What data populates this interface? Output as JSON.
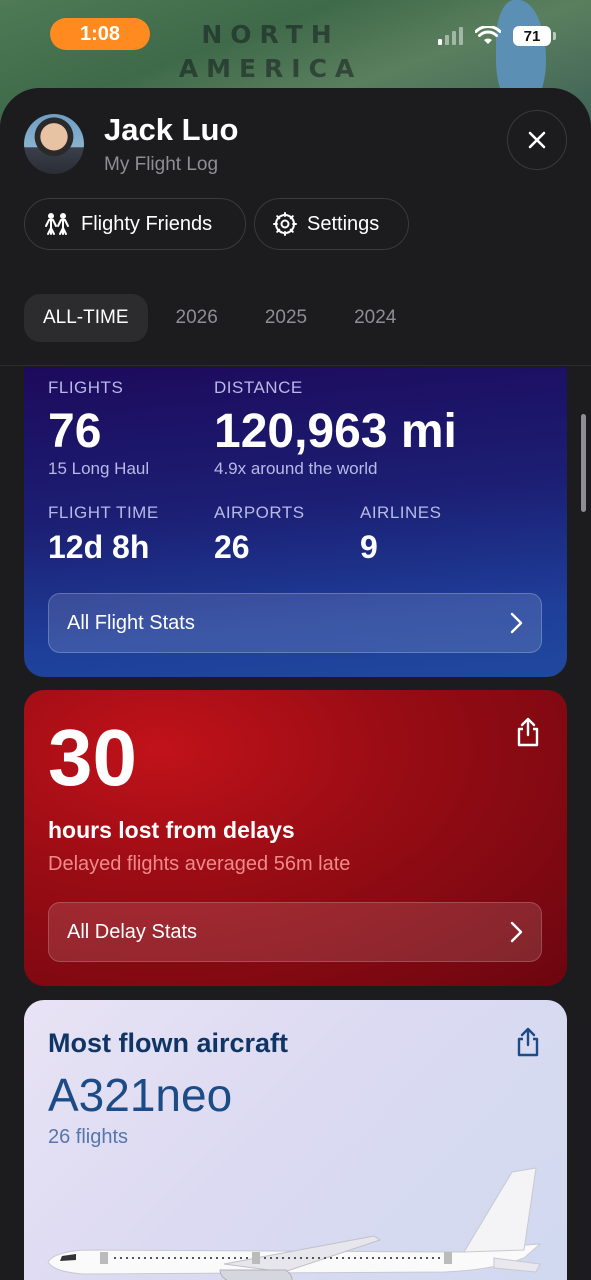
{
  "status_bar": {
    "time": "1:08",
    "battery": "71",
    "map_label_line1": "NORTH",
    "map_label_line2": "AMERICA"
  },
  "profile": {
    "name": "Jack Luo",
    "subtitle": "My Flight Log"
  },
  "actions": {
    "friends_label": "Flighty Friends",
    "settings_label": "Settings"
  },
  "tabs": [
    {
      "label": "ALL-TIME",
      "active": true
    },
    {
      "label": "2026",
      "active": false
    },
    {
      "label": "2025",
      "active": false
    },
    {
      "label": "2024",
      "active": false
    }
  ],
  "flight_stats": {
    "flights_label": "FLIGHTS",
    "flights_value": "76",
    "flights_sub": "15 Long Haul",
    "distance_label": "DISTANCE",
    "distance_value": "120,963 mi",
    "distance_sub": "4.9x around the world",
    "time_label": "FLIGHT TIME",
    "time_value": "12d 8h",
    "airports_label": "AIRPORTS",
    "airports_value": "26",
    "airlines_label": "AIRLINES",
    "airlines_value": "9",
    "button_label": "All Flight Stats"
  },
  "delay_stats": {
    "hours": "30",
    "label": "hours lost from delays",
    "sub": "Delayed flights averaged 56m late",
    "button_label": "All Delay Stats"
  },
  "aircraft": {
    "title": "Most flown aircraft",
    "model": "A321neo",
    "count": "26 flights"
  },
  "colors": {
    "accent_orange": "#ff8a1f",
    "stats_blue": "#1e3f9a",
    "delay_red": "#9a0c14",
    "aircraft_text": "#0f3566"
  }
}
